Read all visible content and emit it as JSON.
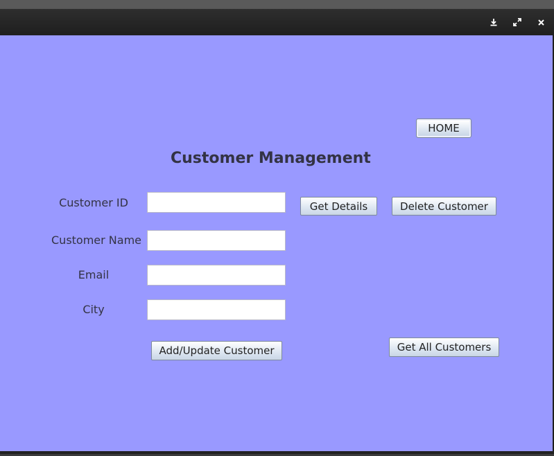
{
  "window": {
    "controls": {
      "minimize_icon": "download-arrow-icon",
      "maximize_icon": "expand-arrows-icon",
      "close_icon": "close-icon"
    }
  },
  "colors": {
    "background": "#9999ff",
    "titlebar": "#222222",
    "title_text": "#333344"
  },
  "home_button": "HOME",
  "page_title": "Customer Management",
  "form": {
    "customer_id_label": "Customer ID",
    "customer_id_value": "",
    "customer_name_label": "Customer Name",
    "customer_name_value": "",
    "email_label": "Email",
    "email_value": "",
    "city_label": "City",
    "city_value": ""
  },
  "buttons": {
    "get_details": "Get Details",
    "delete_customer": "Delete Customer",
    "add_update_customer": "Add/Update Customer",
    "get_all_customers": "Get All Customers"
  }
}
